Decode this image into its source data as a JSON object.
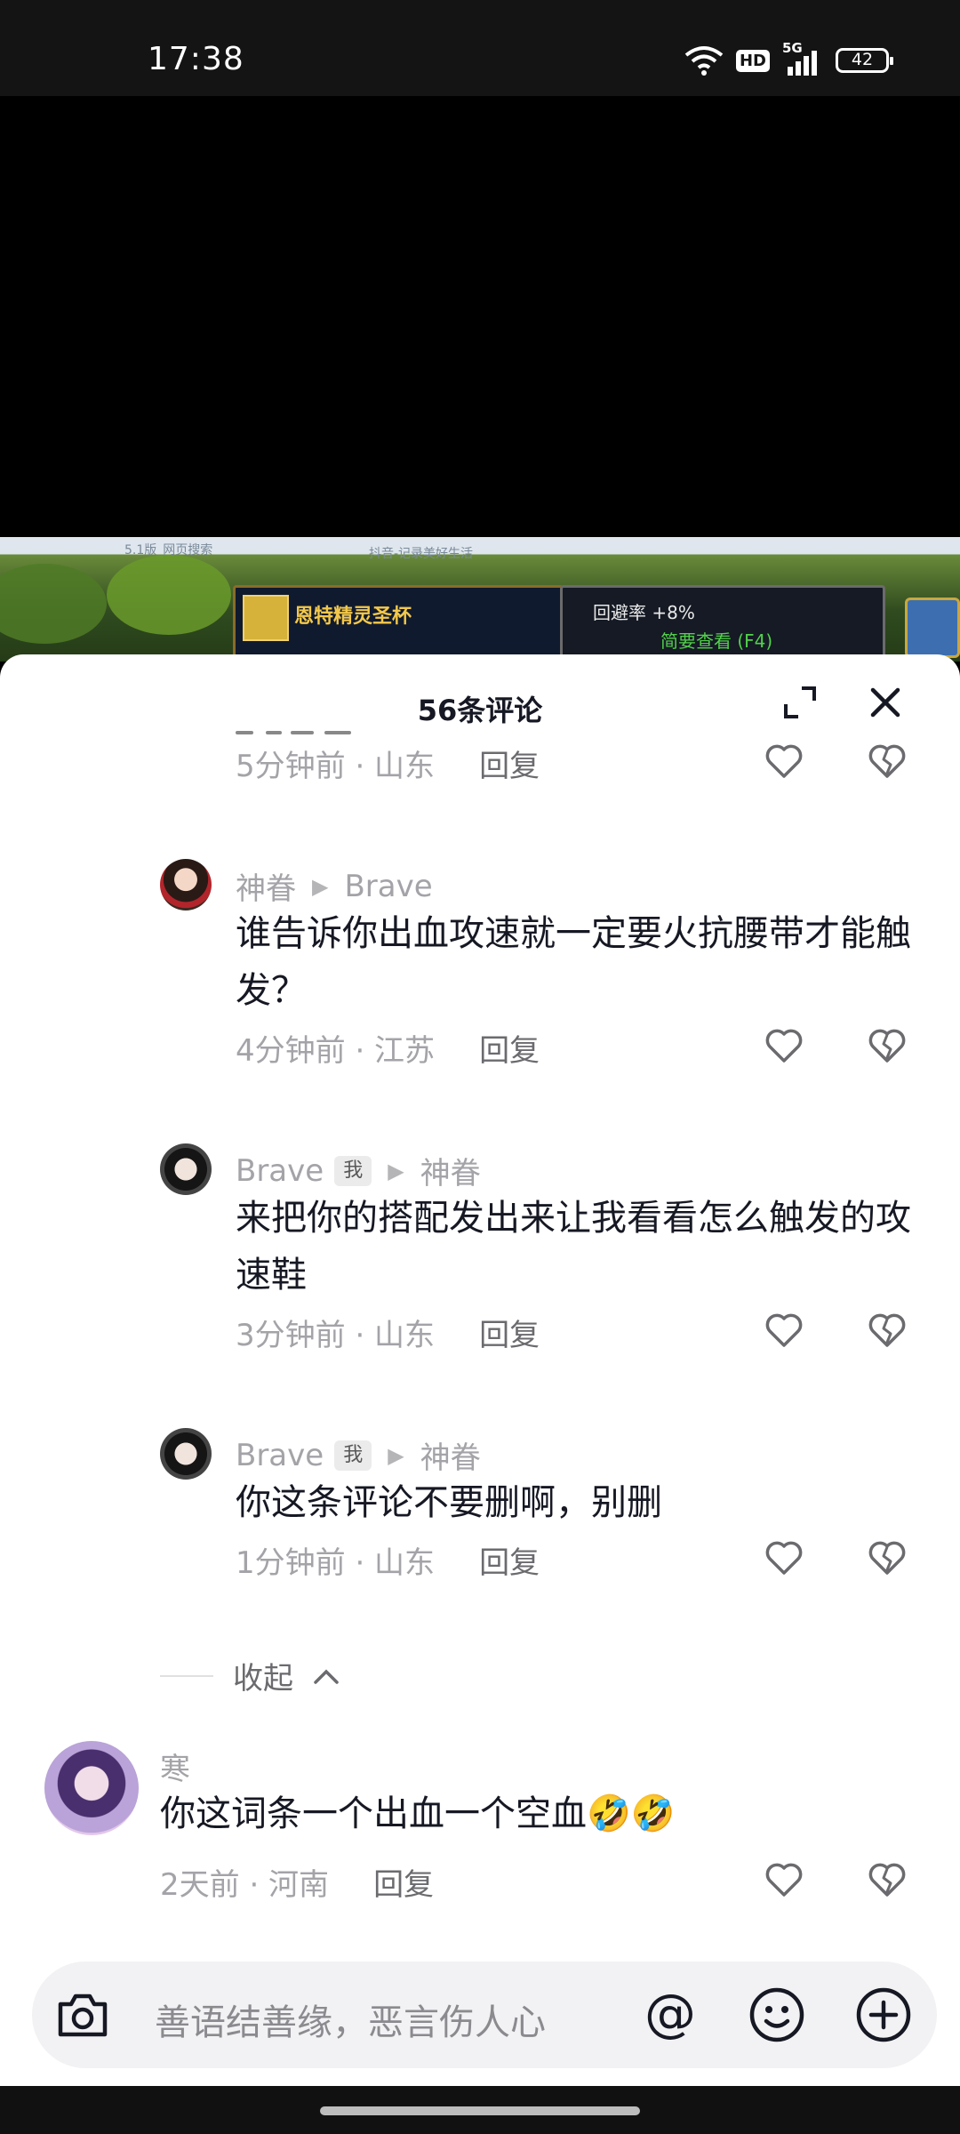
{
  "status_bar": {
    "time": "17:38",
    "network": "5G",
    "hd": "HD",
    "battery": "42"
  },
  "video": {
    "browser_tab_1": "5.1版_网页搜索",
    "browser_tab_2": "抖音-记录美好生活",
    "item_name": "恩特精灵圣杯",
    "stat_line": "回避率 +8%",
    "stat_hint": "简要查看 (F4)"
  },
  "sheet": {
    "title": "56条评论"
  },
  "comments": [
    {
      "time_loc": "5分钟前 · 山东",
      "reply": "回复"
    },
    {
      "user": "神眷",
      "reply_to": "Brave",
      "text": "谁告诉你出血攻速就一定要火抗腰带才能触发？",
      "time_loc": "4分钟前 · 江苏",
      "reply": "回复"
    },
    {
      "user": "Brave",
      "badge": "我",
      "reply_to": "神眷",
      "text": "来把你的搭配发出来让我看看怎么触发的攻速鞋",
      "time_loc": "3分钟前 · 山东",
      "reply": "回复"
    },
    {
      "user": "Brave",
      "badge": "我",
      "reply_to": "神眷",
      "text": "你这条评论不要删啊，别删",
      "time_loc": "1分钟前 · 山东",
      "reply": "回复"
    },
    {
      "user": "寒",
      "text": "你这词条一个出血一个空血",
      "emojis": "🤣🤣",
      "time_loc": "2天前 · 河南",
      "reply": "回复"
    }
  ],
  "collapse": {
    "label": "收起"
  },
  "input_bar": {
    "placeholder": "善语结善缘，恶言伤人心",
    "at": "@"
  },
  "icons": {
    "expand": "expand-icon",
    "close": "close-icon",
    "like": "heart-icon",
    "dislike": "broken-heart-icon",
    "camera": "camera-icon",
    "emoji": "smile-icon",
    "plus": "plus-icon"
  }
}
